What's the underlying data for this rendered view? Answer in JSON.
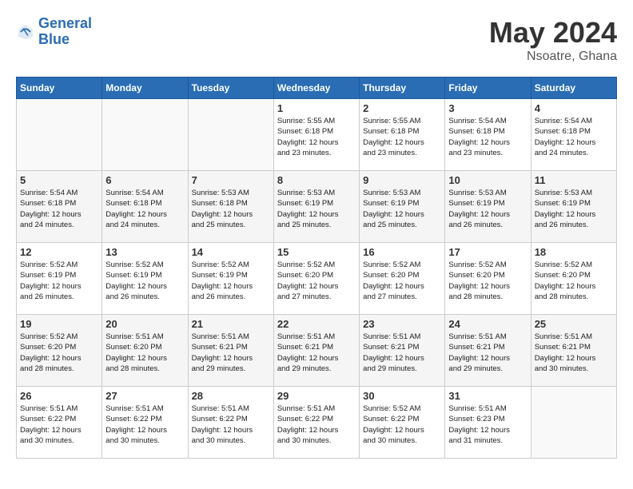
{
  "header": {
    "logo_general": "General",
    "logo_blue": "Blue",
    "month_year": "May 2024",
    "location": "Nsoatre, Ghana"
  },
  "weekdays": [
    "Sunday",
    "Monday",
    "Tuesday",
    "Wednesday",
    "Thursday",
    "Friday",
    "Saturday"
  ],
  "weeks": [
    [
      {
        "day": "",
        "info": ""
      },
      {
        "day": "",
        "info": ""
      },
      {
        "day": "",
        "info": ""
      },
      {
        "day": "1",
        "info": "Sunrise: 5:55 AM\nSunset: 6:18 PM\nDaylight: 12 hours\nand 23 minutes."
      },
      {
        "day": "2",
        "info": "Sunrise: 5:55 AM\nSunset: 6:18 PM\nDaylight: 12 hours\nand 23 minutes."
      },
      {
        "day": "3",
        "info": "Sunrise: 5:54 AM\nSunset: 6:18 PM\nDaylight: 12 hours\nand 23 minutes."
      },
      {
        "day": "4",
        "info": "Sunrise: 5:54 AM\nSunset: 6:18 PM\nDaylight: 12 hours\nand 24 minutes."
      }
    ],
    [
      {
        "day": "5",
        "info": "Sunrise: 5:54 AM\nSunset: 6:18 PM\nDaylight: 12 hours\nand 24 minutes."
      },
      {
        "day": "6",
        "info": "Sunrise: 5:54 AM\nSunset: 6:18 PM\nDaylight: 12 hours\nand 24 minutes."
      },
      {
        "day": "7",
        "info": "Sunrise: 5:53 AM\nSunset: 6:18 PM\nDaylight: 12 hours\nand 25 minutes."
      },
      {
        "day": "8",
        "info": "Sunrise: 5:53 AM\nSunset: 6:19 PM\nDaylight: 12 hours\nand 25 minutes."
      },
      {
        "day": "9",
        "info": "Sunrise: 5:53 AM\nSunset: 6:19 PM\nDaylight: 12 hours\nand 25 minutes."
      },
      {
        "day": "10",
        "info": "Sunrise: 5:53 AM\nSunset: 6:19 PM\nDaylight: 12 hours\nand 26 minutes."
      },
      {
        "day": "11",
        "info": "Sunrise: 5:53 AM\nSunset: 6:19 PM\nDaylight: 12 hours\nand 26 minutes."
      }
    ],
    [
      {
        "day": "12",
        "info": "Sunrise: 5:52 AM\nSunset: 6:19 PM\nDaylight: 12 hours\nand 26 minutes."
      },
      {
        "day": "13",
        "info": "Sunrise: 5:52 AM\nSunset: 6:19 PM\nDaylight: 12 hours\nand 26 minutes."
      },
      {
        "day": "14",
        "info": "Sunrise: 5:52 AM\nSunset: 6:19 PM\nDaylight: 12 hours\nand 26 minutes."
      },
      {
        "day": "15",
        "info": "Sunrise: 5:52 AM\nSunset: 6:20 PM\nDaylight: 12 hours\nand 27 minutes."
      },
      {
        "day": "16",
        "info": "Sunrise: 5:52 AM\nSunset: 6:20 PM\nDaylight: 12 hours\nand 27 minutes."
      },
      {
        "day": "17",
        "info": "Sunrise: 5:52 AM\nSunset: 6:20 PM\nDaylight: 12 hours\nand 28 minutes."
      },
      {
        "day": "18",
        "info": "Sunrise: 5:52 AM\nSunset: 6:20 PM\nDaylight: 12 hours\nand 28 minutes."
      }
    ],
    [
      {
        "day": "19",
        "info": "Sunrise: 5:52 AM\nSunset: 6:20 PM\nDaylight: 12 hours\nand 28 minutes."
      },
      {
        "day": "20",
        "info": "Sunrise: 5:51 AM\nSunset: 6:20 PM\nDaylight: 12 hours\nand 28 minutes."
      },
      {
        "day": "21",
        "info": "Sunrise: 5:51 AM\nSunset: 6:21 PM\nDaylight: 12 hours\nand 29 minutes."
      },
      {
        "day": "22",
        "info": "Sunrise: 5:51 AM\nSunset: 6:21 PM\nDaylight: 12 hours\nand 29 minutes."
      },
      {
        "day": "23",
        "info": "Sunrise: 5:51 AM\nSunset: 6:21 PM\nDaylight: 12 hours\nand 29 minutes."
      },
      {
        "day": "24",
        "info": "Sunrise: 5:51 AM\nSunset: 6:21 PM\nDaylight: 12 hours\nand 29 minutes."
      },
      {
        "day": "25",
        "info": "Sunrise: 5:51 AM\nSunset: 6:21 PM\nDaylight: 12 hours\nand 30 minutes."
      }
    ],
    [
      {
        "day": "26",
        "info": "Sunrise: 5:51 AM\nSunset: 6:22 PM\nDaylight: 12 hours\nand 30 minutes."
      },
      {
        "day": "27",
        "info": "Sunrise: 5:51 AM\nSunset: 6:22 PM\nDaylight: 12 hours\nand 30 minutes."
      },
      {
        "day": "28",
        "info": "Sunrise: 5:51 AM\nSunset: 6:22 PM\nDaylight: 12 hours\nand 30 minutes."
      },
      {
        "day": "29",
        "info": "Sunrise: 5:51 AM\nSunset: 6:22 PM\nDaylight: 12 hours\nand 30 minutes."
      },
      {
        "day": "30",
        "info": "Sunrise: 5:52 AM\nSunset: 6:22 PM\nDaylight: 12 hours\nand 30 minutes."
      },
      {
        "day": "31",
        "info": "Sunrise: 5:51 AM\nSunset: 6:23 PM\nDaylight: 12 hours\nand 31 minutes."
      },
      {
        "day": "",
        "info": ""
      }
    ]
  ]
}
